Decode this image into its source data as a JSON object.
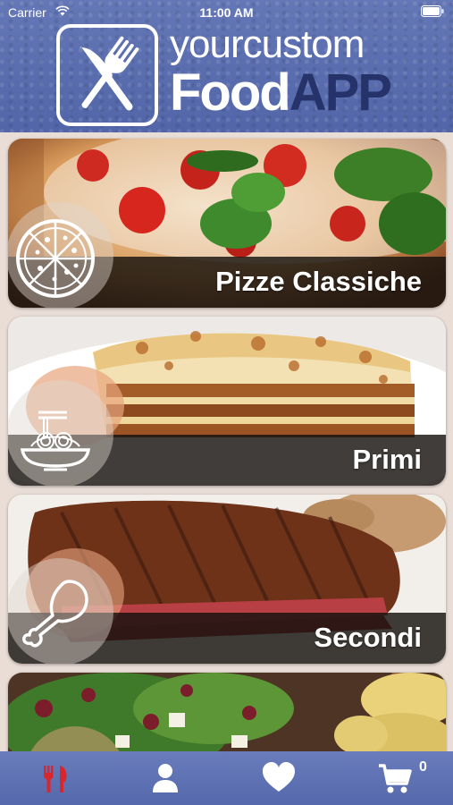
{
  "status_bar": {
    "carrier": "Carrier",
    "time": "11:00 AM"
  },
  "logo": {
    "line1_a": "your",
    "line1_b": "custom",
    "line2_a": "Food",
    "line2_b": "APP",
    "icon": "fork-knife-icon"
  },
  "categories": [
    {
      "title": "Pizze Classiche",
      "icon": "pizza-icon"
    },
    {
      "title": "Primi",
      "icon": "pasta-bowl-icon"
    },
    {
      "title": "Secondi",
      "icon": "chicken-leg-icon"
    },
    {
      "title": "",
      "icon": ""
    }
  ],
  "tabbar": {
    "tabs": [
      {
        "icon": "fork-knife-icon",
        "active": true
      },
      {
        "icon": "user-icon",
        "active": false
      },
      {
        "icon": "heart-icon",
        "active": false
      },
      {
        "icon": "cart-icon",
        "active": false
      }
    ],
    "cart_count": "0"
  },
  "colors": {
    "header": "#5a6eaf",
    "app_dark": "#25336a",
    "active_tab": "#d9262c",
    "tab_icon": "#ffffff"
  }
}
